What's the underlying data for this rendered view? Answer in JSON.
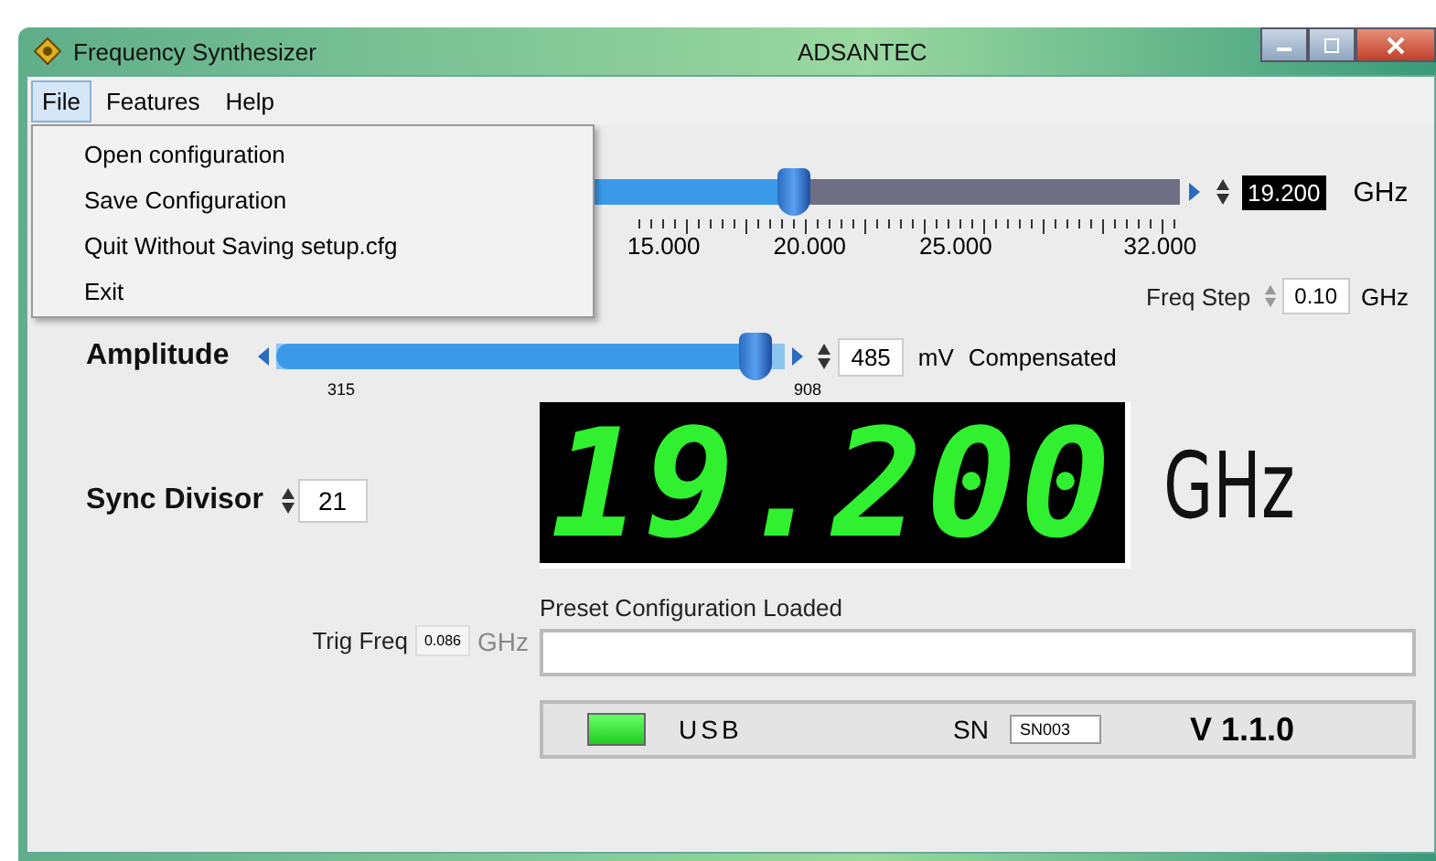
{
  "window": {
    "title": "Frequency Synthesizer",
    "company": "ADSANTEC"
  },
  "menu_bar": [
    {
      "label": "File",
      "selected": true
    },
    {
      "label": "Features",
      "selected": false
    },
    {
      "label": "Help",
      "selected": false
    }
  ],
  "file_menu": [
    "Open configuration",
    "Save  Configuration",
    "Quit Without Saving setup.cfg",
    "Exit"
  ],
  "frequency": {
    "level": 0.55,
    "ticks": [
      "15.000",
      "20.000",
      "25.000",
      "32.000"
    ],
    "value": "19.200",
    "unit": "GHz",
    "step_label": "Freq Step",
    "step": "0.10",
    "step_unit": "GHz"
  },
  "amplitude": {
    "label": "Amplitude",
    "level": 0.94,
    "min": "315",
    "max": "908",
    "value": "485",
    "unit": "mV",
    "mode": "Compensated"
  },
  "sync_divisor": {
    "label": "Sync Divisor",
    "value": "21"
  },
  "display": {
    "value": "19.200",
    "unit": "GHz"
  },
  "trig_freq": {
    "label": "Trig Freq",
    "value": "0.086",
    "unit": "GHz"
  },
  "preset": {
    "label": "Preset Configuration Loaded"
  },
  "status_bar": {
    "usb_connected": true,
    "usb_label": "USB",
    "sn_label": "SN",
    "sn": "SN003",
    "version": "V 1.1.0"
  }
}
